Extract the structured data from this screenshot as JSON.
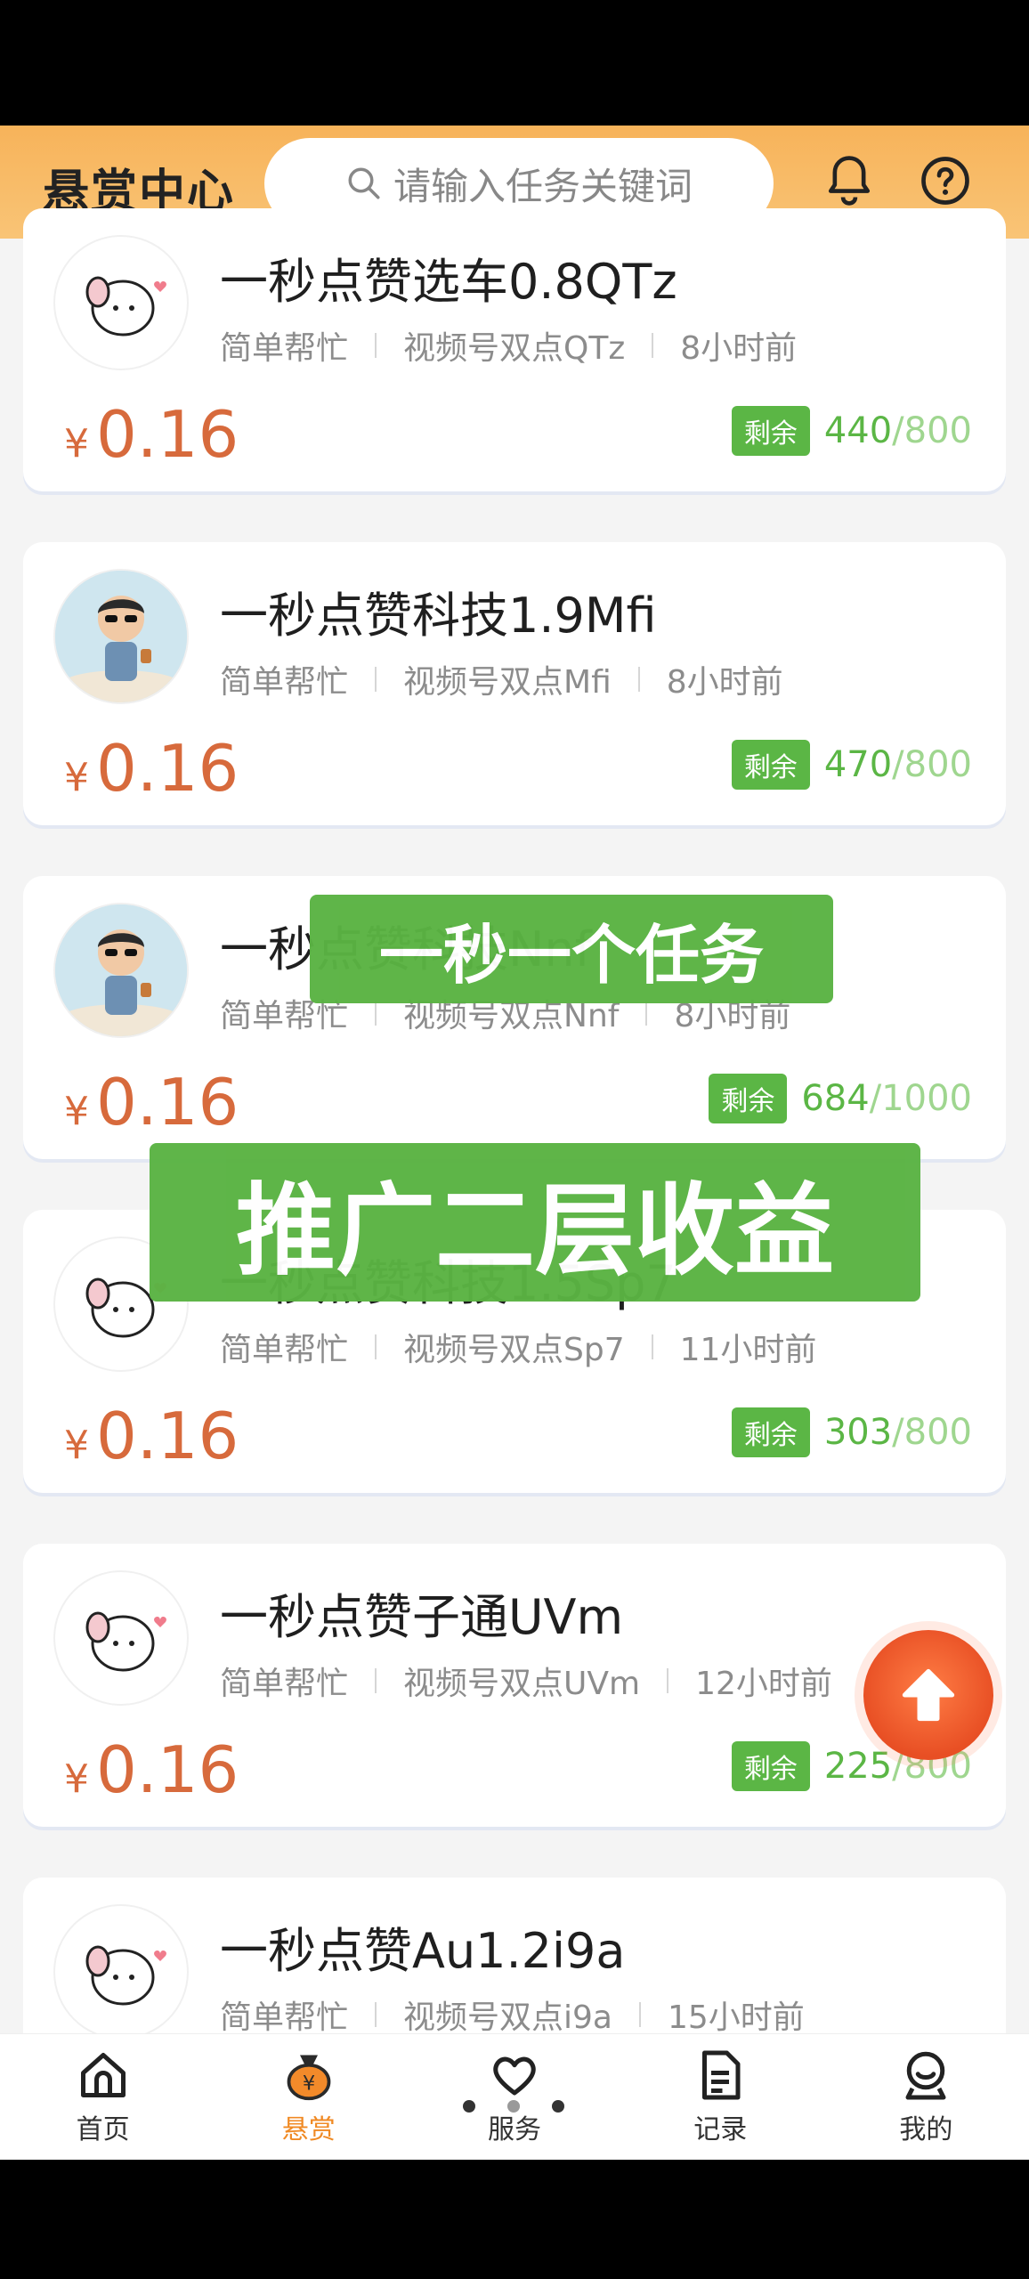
{
  "header": {
    "title": "悬赏中心",
    "search_placeholder": "请输入任务关键词",
    "icons": [
      "bell-icon",
      "help-icon"
    ]
  },
  "tasks": [
    {
      "title": "一秒点赞选车0.8QTz",
      "category": "简单帮忙",
      "type": "视频号双点QTz",
      "time": "8小时前",
      "currency": "¥",
      "price": "0.16",
      "remain_label": "剩余",
      "remain": "440",
      "total": "/800",
      "avatar": "ghost"
    },
    {
      "title": "一秒点赞科技1.9Mfi",
      "category": "简单帮忙",
      "type": "视频号双点Mfi",
      "time": "8小时前",
      "currency": "¥",
      "price": "0.16",
      "remain_label": "剩余",
      "remain": "470",
      "total": "/800",
      "avatar": "boy"
    },
    {
      "title": "一秒点赞科技Nnf",
      "category": "简单帮忙",
      "type": "视频号双点Nnf",
      "time": "8小时前",
      "currency": "¥",
      "price": "0.16",
      "remain_label": "剩余",
      "remain": "684",
      "total": "/1000",
      "avatar": "boy"
    },
    {
      "title": "一秒点赞科技1.5Sp7",
      "category": "简单帮忙",
      "type": "视频号双点Sp7",
      "time": "11小时前",
      "currency": "¥",
      "price": "0.16",
      "remain_label": "剩余",
      "remain": "303",
      "total": "/800",
      "avatar": "ghost"
    },
    {
      "title": "一秒点赞子通UVm",
      "category": "简单帮忙",
      "type": "视频号双点UVm",
      "time": "12小时前",
      "currency": "¥",
      "price": "0.16",
      "remain_label": "剩余",
      "remain": "225",
      "total": "/800",
      "avatar": "ghost"
    },
    {
      "title": "一秒点赞Au1.2i9a",
      "category": "简单帮忙",
      "type": "视频号双点i9a",
      "time": "15小时前",
      "avatar": "ghost"
    }
  ],
  "overlays": {
    "caption1": "一秒一个任务",
    "caption2": "推广二层收益"
  },
  "tabbar": [
    {
      "label": "首页",
      "icon": "home-icon",
      "active": false
    },
    {
      "label": "悬赏",
      "icon": "money-bag-icon",
      "active": true
    },
    {
      "label": "服务",
      "icon": "heart-icon",
      "active": false
    },
    {
      "label": "记录",
      "icon": "document-icon",
      "active": false
    },
    {
      "label": "我的",
      "icon": "profile-icon",
      "active": false
    }
  ],
  "colors": {
    "header": "#f7b35a",
    "price": "#d76a3c",
    "green": "#5bb645",
    "active_tab": "#f08a24"
  }
}
